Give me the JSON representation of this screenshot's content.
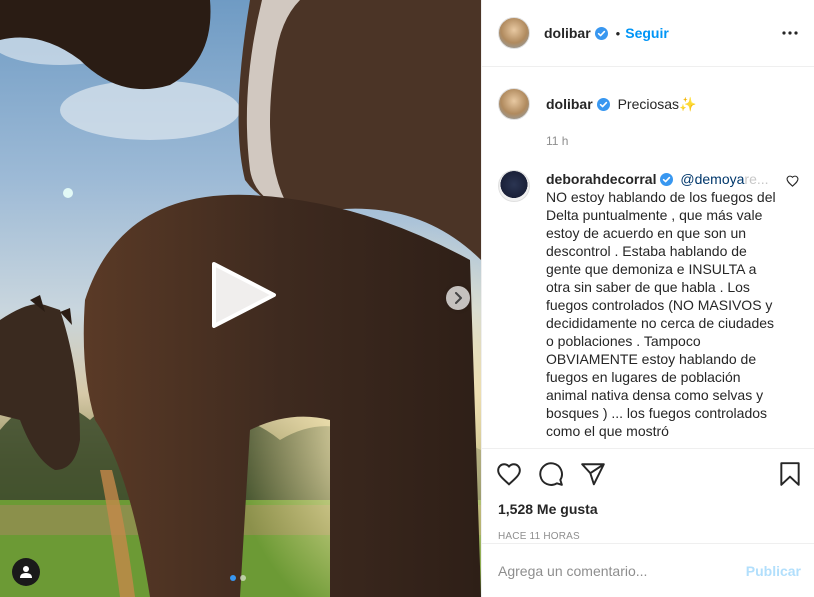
{
  "post": {
    "author": "dolibar",
    "follow_label": "Seguir",
    "bullet": "•"
  },
  "caption": {
    "username": "dolibar",
    "text": "Preciosas",
    "emoji": "✨",
    "time": "11 h"
  },
  "comment": {
    "username": "deborahdecorral",
    "mention": "@demoya",
    "mention_fade": "re...",
    "text": "NO estoy hablando de los fuegos del Delta puntualmente , que más vale estoy de acuerdo en que son un descontrol . Estaba hablando de gente que demoniza e INSULTA a otra sin saber de que habla . Los fuegos controlados (NO MASIVOS y decididamente no cerca de ciudades o poblaciones . Tampoco OBVIAMENTE estoy hablando de fuegos en lugares de población animal nativa densa como selvas y bosques ) ... los fuegos controlados como el que mostró"
  },
  "stats": {
    "likes": "1,528 Me gusta",
    "posted": "HACE 11 HORAS"
  },
  "composer": {
    "placeholder": "Agrega un comentario...",
    "publish": "Publicar"
  },
  "icons": {
    "verified": "verified-badge-icon",
    "more": "more-options-icon",
    "like": "heart-icon",
    "comment": "comment-icon",
    "share": "share-icon",
    "save": "bookmark-icon",
    "play": "play-icon",
    "next": "chevron-right-icon",
    "tag": "user-tag-icon"
  },
  "colors": {
    "link_blue": "#0095f6",
    "verified_blue": "#3897f0",
    "publish_disabled": "#b2dffc"
  },
  "carousel": {
    "count": 2,
    "active": 1
  }
}
